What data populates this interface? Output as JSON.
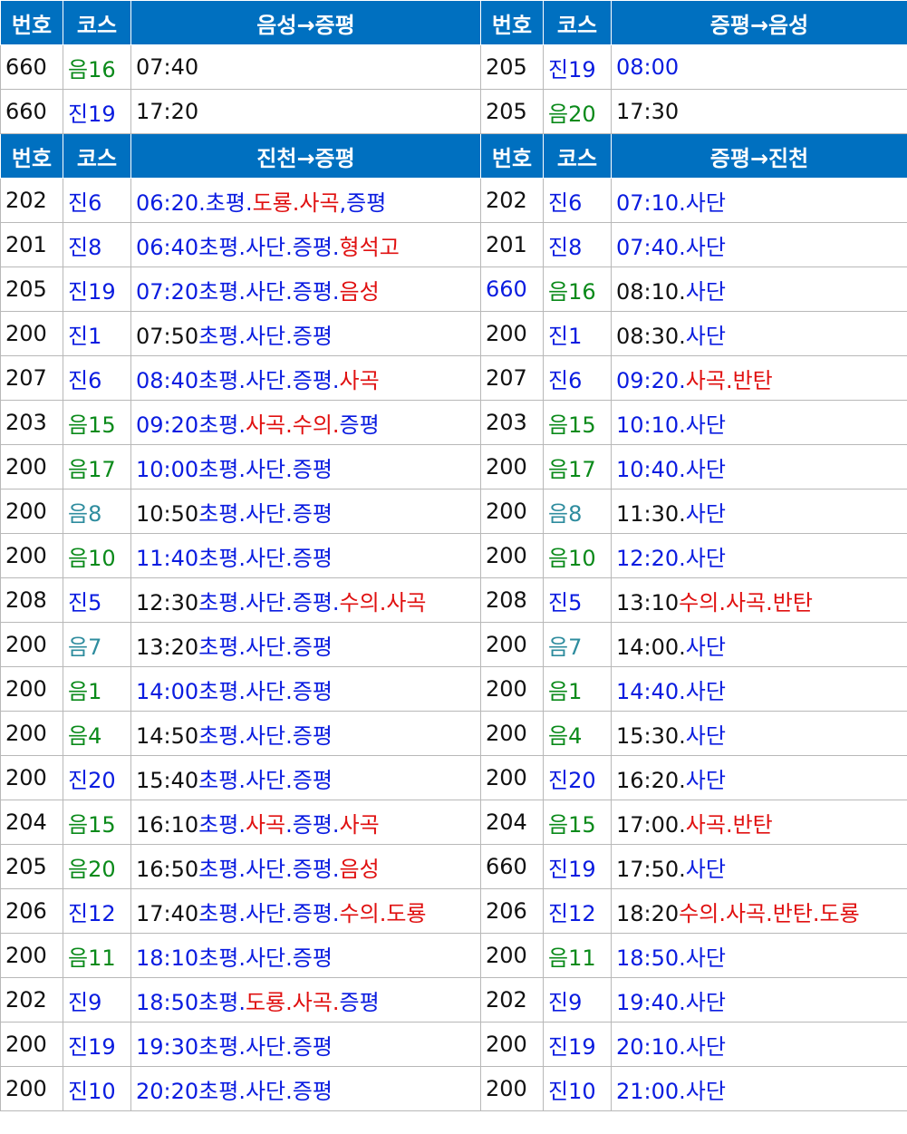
{
  "colors": {
    "header_bg": "#0070c0",
    "header_text": "#ffffff",
    "k": "#111111",
    "b": "#0a1ce0",
    "r": "#e01010",
    "g": "#0a8a1a",
    "t": "#2e8c9e"
  },
  "sections": [
    {
      "header": {
        "no": "번호",
        "course": "코스",
        "route_left": "음성→증평",
        "no2": "번호",
        "course2": "코스",
        "route_right": "증평→음성"
      },
      "rows": [
        {
          "l_no": {
            "t": "660",
            "c": "k"
          },
          "l_course": {
            "t": "음16",
            "c": "g"
          },
          "l_sched": [
            {
              "t": "07:40",
              "c": "k"
            }
          ],
          "r_no": {
            "t": "205",
            "c": "k"
          },
          "r_course": {
            "t": "진19",
            "c": "b"
          },
          "r_sched": [
            {
              "t": "08:00",
              "c": "b"
            }
          ]
        },
        {
          "l_no": {
            "t": "660",
            "c": "k"
          },
          "l_course": {
            "t": "진19",
            "c": "b"
          },
          "l_sched": [
            {
              "t": "17:20",
              "c": "k"
            }
          ],
          "r_no": {
            "t": "205",
            "c": "k"
          },
          "r_course": {
            "t": "음20",
            "c": "g"
          },
          "r_sched": [
            {
              "t": "17:30",
              "c": "k"
            }
          ]
        }
      ]
    },
    {
      "header": {
        "no": "번호",
        "course": "코스",
        "route_left": "진천→증평",
        "no2": "번호",
        "course2": "코스",
        "route_right": "증평→진천"
      },
      "rows": [
        {
          "l_no": {
            "t": "202",
            "c": "k"
          },
          "l_course": {
            "t": "진6",
            "c": "b"
          },
          "l_sched": [
            {
              "t": "06:20.초평.",
              "c": "b"
            },
            {
              "t": "도룡.사곡",
              "c": "r"
            },
            {
              "t": ",증평",
              "c": "b"
            }
          ],
          "r_no": {
            "t": "202",
            "c": "k"
          },
          "r_course": {
            "t": "진6",
            "c": "b"
          },
          "r_sched": [
            {
              "t": "07:10.사단",
              "c": "b"
            }
          ]
        },
        {
          "l_no": {
            "t": "201",
            "c": "k"
          },
          "l_course": {
            "t": "진8",
            "c": "b"
          },
          "l_sched": [
            {
              "t": "06:40초평.사단.증평.",
              "c": "b"
            },
            {
              "t": "형석고",
              "c": "r"
            }
          ],
          "r_no": {
            "t": "201",
            "c": "k"
          },
          "r_course": {
            "t": "진8",
            "c": "b"
          },
          "r_sched": [
            {
              "t": "07:40.사단",
              "c": "b"
            }
          ]
        },
        {
          "l_no": {
            "t": "205",
            "c": "k"
          },
          "l_course": {
            "t": "진19",
            "c": "b"
          },
          "l_sched": [
            {
              "t": "07:20초평.사단.증평.",
              "c": "b"
            },
            {
              "t": "음성",
              "c": "r"
            }
          ],
          "r_no": {
            "t": "660",
            "c": "b"
          },
          "r_course": {
            "t": "음16",
            "c": "g"
          },
          "r_sched": [
            {
              "t": "08:10.",
              "c": "k"
            },
            {
              "t": "사단",
              "c": "b"
            }
          ]
        },
        {
          "l_no": {
            "t": "200",
            "c": "k"
          },
          "l_course": {
            "t": "진1",
            "c": "b"
          },
          "l_sched": [
            {
              "t": "07:50",
              "c": "k"
            },
            {
              "t": "초평.사단.증평",
              "c": "b"
            }
          ],
          "r_no": {
            "t": "200",
            "c": "k"
          },
          "r_course": {
            "t": "진1",
            "c": "b"
          },
          "r_sched": [
            {
              "t": "08:30.",
              "c": "k"
            },
            {
              "t": "사단",
              "c": "b"
            }
          ]
        },
        {
          "l_no": {
            "t": "207",
            "c": "k"
          },
          "l_course": {
            "t": "진6",
            "c": "b"
          },
          "l_sched": [
            {
              "t": "08:40초평.사단.증평.",
              "c": "b"
            },
            {
              "t": "사곡",
              "c": "r"
            }
          ],
          "r_no": {
            "t": "207",
            "c": "k"
          },
          "r_course": {
            "t": "진6",
            "c": "b"
          },
          "r_sched": [
            {
              "t": "09:20.",
              "c": "b"
            },
            {
              "t": "사곡.반탄",
              "c": "r"
            }
          ]
        },
        {
          "l_no": {
            "t": "203",
            "c": "k"
          },
          "l_course": {
            "t": "음15",
            "c": "g"
          },
          "l_sched": [
            {
              "t": "09:20초평.",
              "c": "b"
            },
            {
              "t": "사곡.수의.",
              "c": "r"
            },
            {
              "t": "증평",
              "c": "b"
            }
          ],
          "r_no": {
            "t": "203",
            "c": "k"
          },
          "r_course": {
            "t": "음15",
            "c": "g"
          },
          "r_sched": [
            {
              "t": "10:10.사단",
              "c": "b"
            }
          ]
        },
        {
          "l_no": {
            "t": "200",
            "c": "k"
          },
          "l_course": {
            "t": "음17",
            "c": "g"
          },
          "l_sched": [
            {
              "t": "10:00초평.사단.증평",
              "c": "b"
            }
          ],
          "r_no": {
            "t": "200",
            "c": "k"
          },
          "r_course": {
            "t": "음17",
            "c": "g"
          },
          "r_sched": [
            {
              "t": "10:40.사단",
              "c": "b"
            }
          ]
        },
        {
          "l_no": {
            "t": "200",
            "c": "k"
          },
          "l_course": {
            "t": "음8",
            "c": "t"
          },
          "l_sched": [
            {
              "t": "10:50",
              "c": "k"
            },
            {
              "t": "초평.사단.증평",
              "c": "b"
            }
          ],
          "r_no": {
            "t": "200",
            "c": "k"
          },
          "r_course": {
            "t": "음8",
            "c": "t"
          },
          "r_sched": [
            {
              "t": "11:30.",
              "c": "k"
            },
            {
              "t": "사단",
              "c": "b"
            }
          ]
        },
        {
          "l_no": {
            "t": "200",
            "c": "k"
          },
          "l_course": {
            "t": "음10",
            "c": "g"
          },
          "l_sched": [
            {
              "t": "11:40초평.사단.증평",
              "c": "b"
            }
          ],
          "r_no": {
            "t": "200",
            "c": "k"
          },
          "r_course": {
            "t": "음10",
            "c": "g"
          },
          "r_sched": [
            {
              "t": "12:20.사단",
              "c": "b"
            }
          ]
        },
        {
          "l_no": {
            "t": "208",
            "c": "k"
          },
          "l_course": {
            "t": "진5",
            "c": "b"
          },
          "l_sched": [
            {
              "t": "12:30",
              "c": "k"
            },
            {
              "t": "초평.사단.증평.",
              "c": "b"
            },
            {
              "t": "수의.사곡",
              "c": "r"
            }
          ],
          "r_no": {
            "t": "208",
            "c": "k"
          },
          "r_course": {
            "t": "진5",
            "c": "b"
          },
          "r_sched": [
            {
              "t": "13:10",
              "c": "k"
            },
            {
              "t": "수의.사곡.반탄",
              "c": "r"
            }
          ]
        },
        {
          "l_no": {
            "t": "200",
            "c": "k"
          },
          "l_course": {
            "t": "음7",
            "c": "t"
          },
          "l_sched": [
            {
              "t": "13:20",
              "c": "k"
            },
            {
              "t": "초평.사단.증평",
              "c": "b"
            }
          ],
          "r_no": {
            "t": "200",
            "c": "k"
          },
          "r_course": {
            "t": "음7",
            "c": "t"
          },
          "r_sched": [
            {
              "t": "14:00.",
              "c": "k"
            },
            {
              "t": "사단",
              "c": "b"
            }
          ]
        },
        {
          "l_no": {
            "t": "200",
            "c": "k"
          },
          "l_course": {
            "t": "음1",
            "c": "g"
          },
          "l_sched": [
            {
              "t": "14:00초평.사단.증평",
              "c": "b"
            }
          ],
          "r_no": {
            "t": "200",
            "c": "k"
          },
          "r_course": {
            "t": "음1",
            "c": "g"
          },
          "r_sched": [
            {
              "t": "14:40.사단",
              "c": "b"
            }
          ]
        },
        {
          "l_no": {
            "t": "200",
            "c": "k"
          },
          "l_course": {
            "t": "음4",
            "c": "g"
          },
          "l_sched": [
            {
              "t": "14:50",
              "c": "k"
            },
            {
              "t": "초평.사단.증평",
              "c": "b"
            }
          ],
          "r_no": {
            "t": "200",
            "c": "k"
          },
          "r_course": {
            "t": "음4",
            "c": "g"
          },
          "r_sched": [
            {
              "t": "15:30.",
              "c": "k"
            },
            {
              "t": "사단",
              "c": "b"
            }
          ]
        },
        {
          "l_no": {
            "t": "200",
            "c": "k"
          },
          "l_course": {
            "t": "진20",
            "c": "b"
          },
          "l_sched": [
            {
              "t": "15:40",
              "c": "k"
            },
            {
              "t": "초평.사단.증평",
              "c": "b"
            }
          ],
          "r_no": {
            "t": "200",
            "c": "k"
          },
          "r_course": {
            "t": "진20",
            "c": "b"
          },
          "r_sched": [
            {
              "t": "16:20.",
              "c": "k"
            },
            {
              "t": "사단",
              "c": "b"
            }
          ]
        },
        {
          "l_no": {
            "t": "204",
            "c": "k"
          },
          "l_course": {
            "t": "음15",
            "c": "g"
          },
          "l_sched": [
            {
              "t": "16:10",
              "c": "k"
            },
            {
              "t": "초평.",
              "c": "b"
            },
            {
              "t": "사곡",
              "c": "r"
            },
            {
              "t": ".증평.",
              "c": "b"
            },
            {
              "t": "사곡",
              "c": "r"
            }
          ],
          "r_no": {
            "t": "204",
            "c": "k"
          },
          "r_course": {
            "t": "음15",
            "c": "g"
          },
          "r_sched": [
            {
              "t": "17:00.",
              "c": "k"
            },
            {
              "t": "사곡.반탄",
              "c": "r"
            }
          ]
        },
        {
          "l_no": {
            "t": "205",
            "c": "k"
          },
          "l_course": {
            "t": "음20",
            "c": "g"
          },
          "l_sched": [
            {
              "t": "16:50",
              "c": "k"
            },
            {
              "t": "초평.사단.증평.",
              "c": "b"
            },
            {
              "t": "음성",
              "c": "r"
            }
          ],
          "r_no": {
            "t": "660",
            "c": "k"
          },
          "r_course": {
            "t": "진19",
            "c": "b"
          },
          "r_sched": [
            {
              "t": "17:50.",
              "c": "k"
            },
            {
              "t": "사단",
              "c": "b"
            }
          ]
        },
        {
          "l_no": {
            "t": "206",
            "c": "k"
          },
          "l_course": {
            "t": "진12",
            "c": "b"
          },
          "l_sched": [
            {
              "t": "17:40",
              "c": "k"
            },
            {
              "t": "초평.사단.증평.",
              "c": "b"
            },
            {
              "t": "수의.도룡",
              "c": "r"
            }
          ],
          "r_no": {
            "t": "206",
            "c": "k"
          },
          "r_course": {
            "t": "진12",
            "c": "b"
          },
          "r_sched": [
            {
              "t": "18:20",
              "c": "k"
            },
            {
              "t": "수의.사곡.반탄.도룡",
              "c": "r"
            }
          ]
        },
        {
          "l_no": {
            "t": "200",
            "c": "k"
          },
          "l_course": {
            "t": "음11",
            "c": "g"
          },
          "l_sched": [
            {
              "t": "18:10초평.사단.증평",
              "c": "b"
            }
          ],
          "r_no": {
            "t": "200",
            "c": "k"
          },
          "r_course": {
            "t": "음11",
            "c": "g"
          },
          "r_sched": [
            {
              "t": "18:50.사단",
              "c": "b"
            }
          ]
        },
        {
          "l_no": {
            "t": "202",
            "c": "k"
          },
          "l_course": {
            "t": "진9",
            "c": "b"
          },
          "l_sched": [
            {
              "t": "18:50초평.",
              "c": "b"
            },
            {
              "t": "도룡.사곡.",
              "c": "r"
            },
            {
              "t": "증평",
              "c": "b"
            }
          ],
          "r_no": {
            "t": "202",
            "c": "k"
          },
          "r_course": {
            "t": "진9",
            "c": "b"
          },
          "r_sched": [
            {
              "t": "19:40.사단",
              "c": "b"
            }
          ]
        },
        {
          "l_no": {
            "t": "200",
            "c": "k"
          },
          "l_course": {
            "t": "진19",
            "c": "b"
          },
          "l_sched": [
            {
              "t": "19:30초평.사단.증평",
              "c": "b"
            }
          ],
          "r_no": {
            "t": "200",
            "c": "k"
          },
          "r_course": {
            "t": "진19",
            "c": "b"
          },
          "r_sched": [
            {
              "t": "20:10.사단",
              "c": "b"
            }
          ]
        },
        {
          "l_no": {
            "t": "200",
            "c": "k"
          },
          "l_course": {
            "t": "진10",
            "c": "b"
          },
          "l_sched": [
            {
              "t": "20:20초평.사단.증평",
              "c": "b"
            }
          ],
          "r_no": {
            "t": "200",
            "c": "k"
          },
          "r_course": {
            "t": "진10",
            "c": "b"
          },
          "r_sched": [
            {
              "t": "21:00.사단",
              "c": "b"
            }
          ]
        }
      ]
    }
  ]
}
